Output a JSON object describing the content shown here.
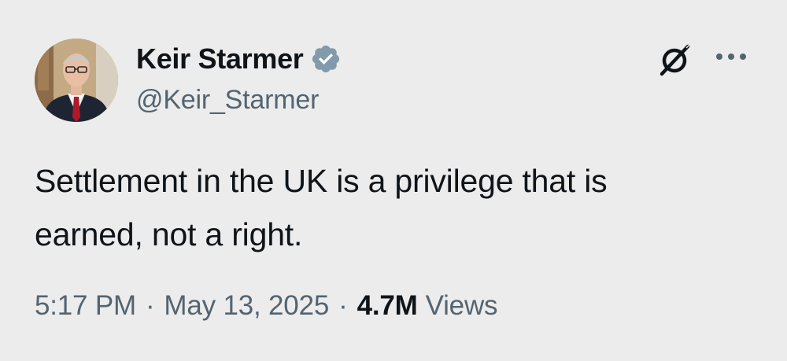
{
  "author": {
    "display_name": "Keir Starmer",
    "handle": "@Keir_Starmer",
    "verified": true,
    "verified_color": "#829aab"
  },
  "tweet": {
    "text_line_1": "Settlement in the UK is a privilege that is",
    "text_line_2": "earned, not a right.",
    "time": "5:17 PM",
    "separator": "·",
    "date": "May 13, 2025",
    "views_count": "4.7M",
    "views_label": "Views"
  },
  "icons": {
    "grok": "grok-icon",
    "more": "more-options-icon",
    "verified": "verified-badge-icon"
  },
  "colors": {
    "background": "#ececec",
    "primary_text": "#0f1419",
    "secondary_text": "#536471"
  }
}
